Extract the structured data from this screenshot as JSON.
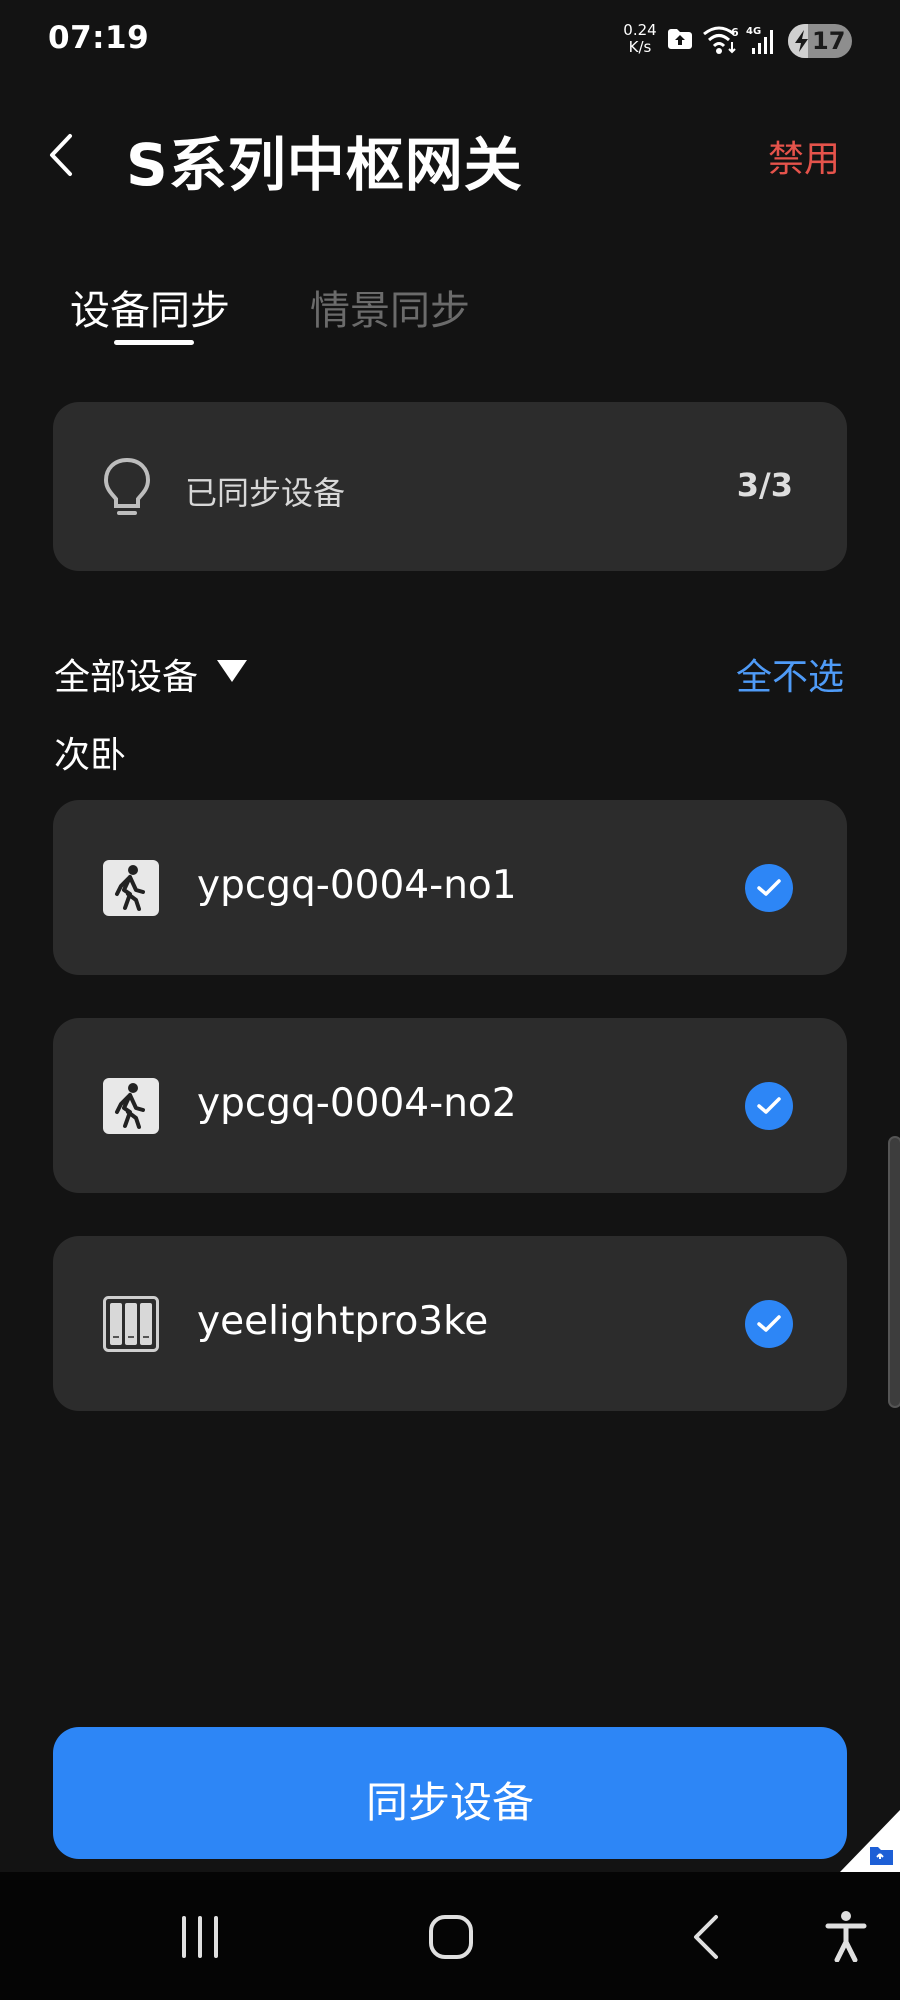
{
  "status_bar": {
    "time": "07:19",
    "net_speed_value": "0.24",
    "net_speed_unit": "K/s",
    "signal_type": "4G",
    "wifi_badge": "6",
    "battery_level": "17",
    "icons": [
      "cloud-upload-icon",
      "wifi-icon",
      "cellular-signal-icon",
      "battery-charging-icon"
    ]
  },
  "header": {
    "title": "S系列中枢网关",
    "action_label": "禁用",
    "action_color": "#e5534b"
  },
  "tabs": [
    {
      "label": "设备同步",
      "active": true
    },
    {
      "label": "情景同步",
      "active": false
    }
  ],
  "summary": {
    "icon": "lightbulb-icon",
    "label": "已同步设备",
    "count": "3/3"
  },
  "filter": {
    "label": "全部设备",
    "deselect_all_label": "全不选",
    "accent_color": "#4f9bf7"
  },
  "room": {
    "name": "次卧"
  },
  "devices": [
    {
      "name": "ypcgq-0004-no1",
      "icon": "motion-sensor-icon",
      "checked": true
    },
    {
      "name": "ypcgq-0004-no2",
      "icon": "motion-sensor-icon",
      "checked": true
    },
    {
      "name": "yeelightpro3ke",
      "icon": "triple-switch-icon",
      "checked": true
    }
  ],
  "sync_button": {
    "label": "同步设备",
    "color": "#2d86f6"
  },
  "nav_bar": {
    "buttons": [
      "recent-apps-icon",
      "home-icon",
      "back-icon",
      "accessibility-icon"
    ]
  }
}
